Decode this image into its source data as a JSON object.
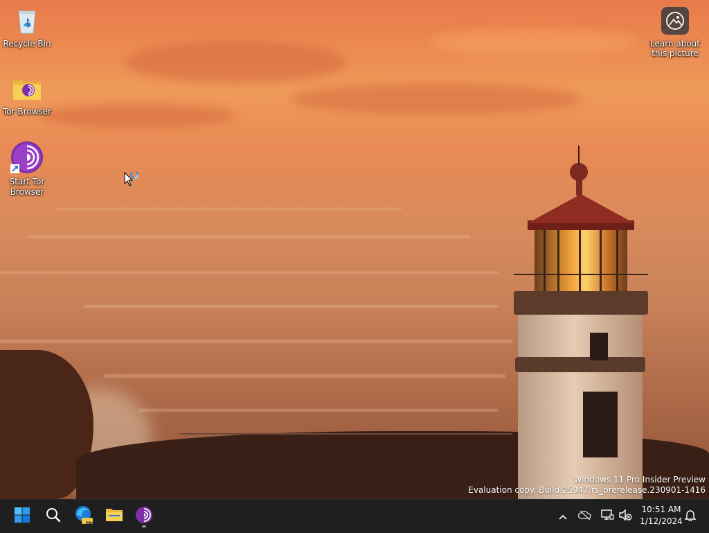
{
  "desktop_icons": [
    {
      "label": "Recycle Bin",
      "icon": "recycle-bin-icon"
    },
    {
      "label": "Tor Browser",
      "icon": "folder-icon"
    },
    {
      "label": "Start Tor Browser",
      "icon": "tor-browser-icon"
    }
  ],
  "learn_picture": {
    "label": "Learn about this picture",
    "icon": "camera-info-icon"
  },
  "watermark": {
    "line1": "Windows 11 Pro Insider Preview",
    "line2": "Evaluation copy. Build 25947.rs_prerelease.230901-1416"
  },
  "taskbar": {
    "apps": [
      {
        "name": "Start",
        "icon": "windows-start-icon"
      },
      {
        "name": "Search",
        "icon": "search-icon"
      },
      {
        "name": "Microsoft Edge Preview",
        "icon": "edge-pre-icon",
        "badge": "PRE"
      },
      {
        "name": "File Explorer",
        "icon": "file-explorer-icon"
      },
      {
        "name": "Tor Browser",
        "icon": "tor-browser-icon"
      }
    ],
    "tray": {
      "time": "10:51 AM",
      "date": "1/12/2024"
    }
  },
  "colors": {
    "taskbar_bg": "#1f1f1f",
    "windows_blue": "#1e90ff",
    "tor_purple": "#7d2fa8"
  }
}
